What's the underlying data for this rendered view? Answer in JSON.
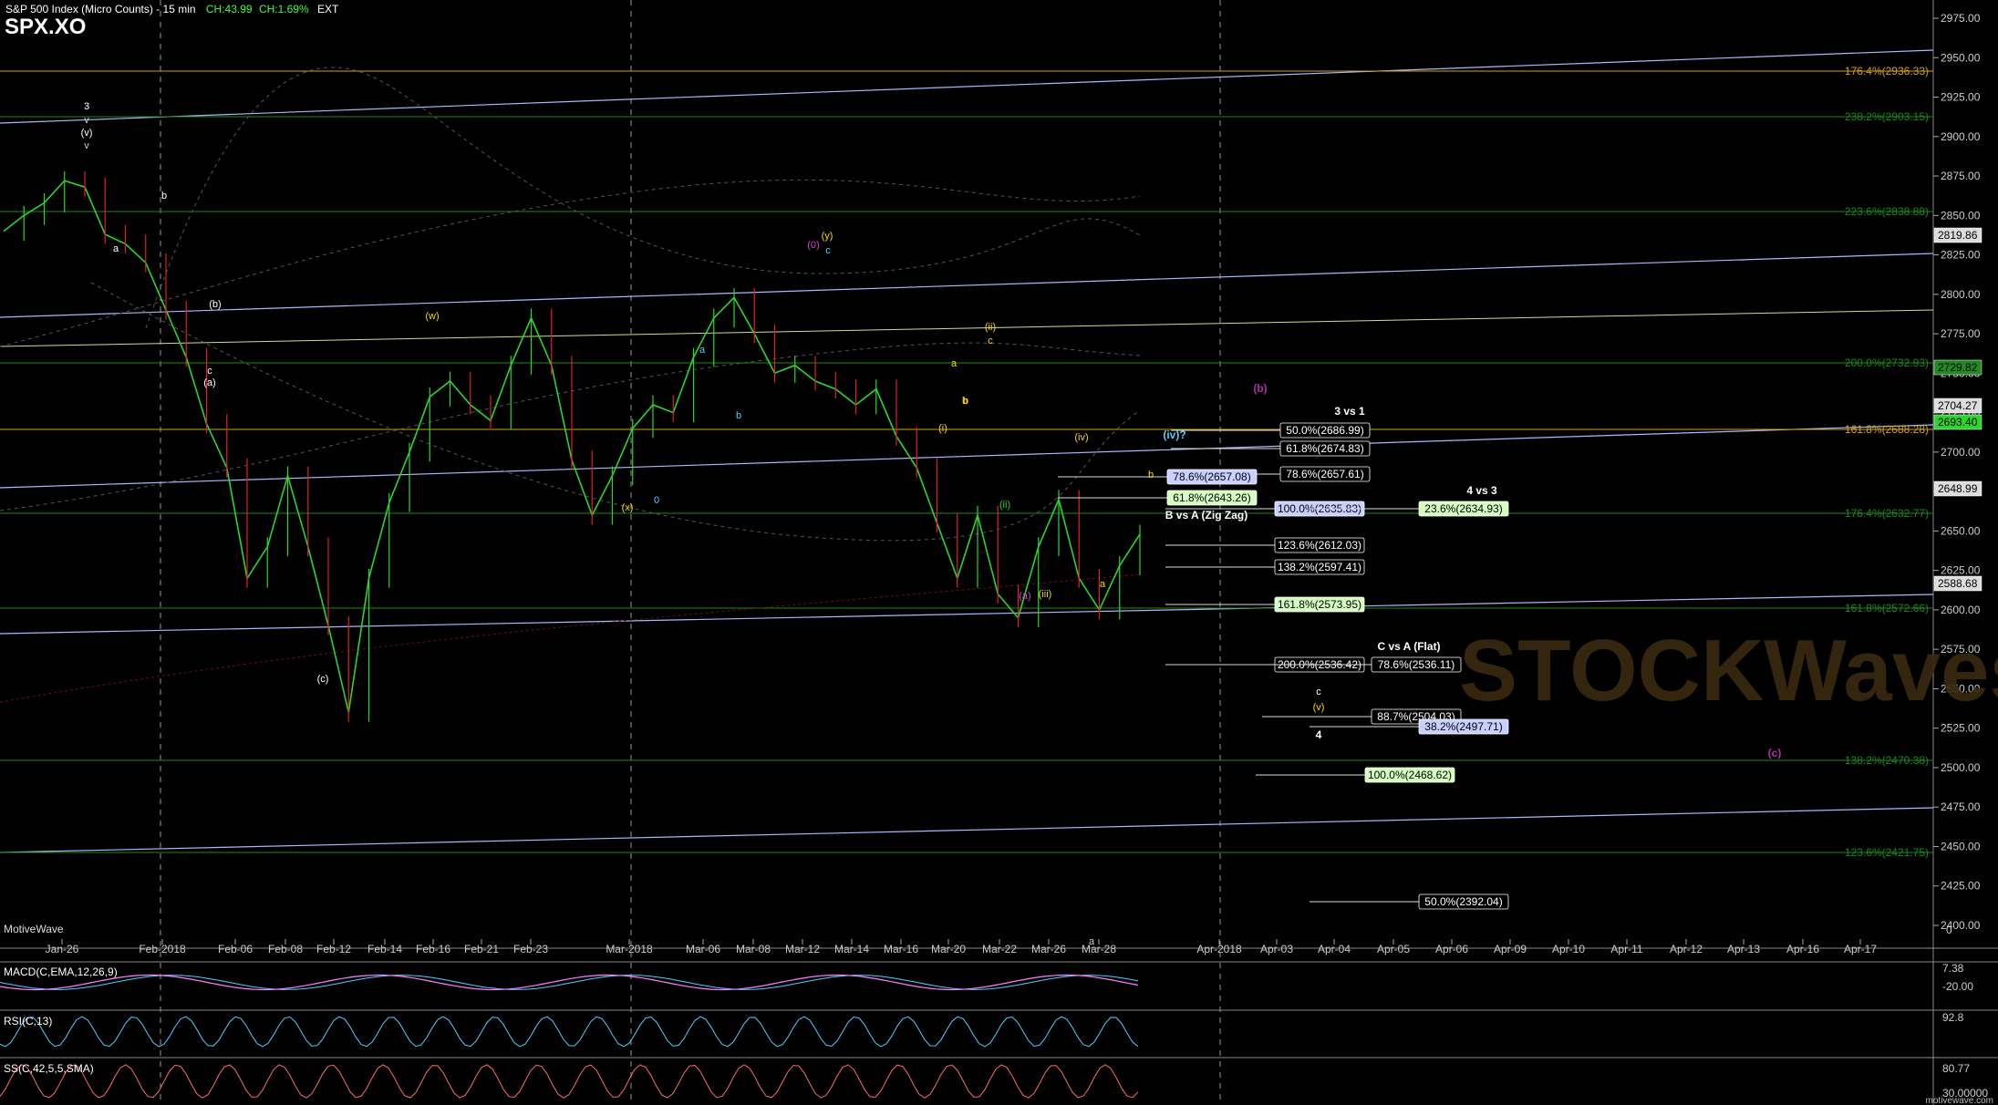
{
  "header": {
    "title": "S&P 500 Index (Micro Counts) - 15 min",
    "change": "CH:43.99",
    "change_pct": "CH:1.69%",
    "ext": "EXT",
    "symbol": "SPX.XO"
  },
  "branding": {
    "label": "MotiveWave",
    "watermark": "STOCKWaves"
  },
  "colors": {
    "background": "#000000",
    "price_up": "#2bd62b",
    "price_down": "#e02020",
    "trend_line": "#aab8ff",
    "fib_green": "#1a8a1a",
    "fib_orange": "#d4a017",
    "grid": "#666666"
  },
  "chart_data": [
    {
      "type": "line",
      "title": "S&P 500 Index (Micro Counts) - 15 min",
      "ylim": [
        2375,
        2990
      ],
      "y_ticks": [
        2975,
        2950,
        2925,
        2900,
        2875,
        2850,
        2825,
        2800,
        2775,
        2750,
        2725,
        2700,
        2675,
        2650,
        2625,
        2600,
        2575,
        2550,
        2525,
        2500,
        2475,
        2450,
        2425,
        2400
      ],
      "x_tick_labels": [
        "Jan-26",
        "Feb-2018",
        "Feb-06",
        "Feb-08",
        "Feb-12",
        "Feb-14",
        "Feb-16",
        "Feb-21",
        "Feb-23",
        "Mar-2018",
        "Mar-06",
        "Mar-08",
        "Mar-12",
        "Mar-14",
        "Mar-16",
        "Mar-20",
        "Mar-22",
        "Mar-26",
        "Mar-28",
        "Apr-2018",
        "Apr-03",
        "Apr-04",
        "Apr-05",
        "Apr-06",
        "Apr-09",
        "Apr-10",
        "Apr-11",
        "Apr-12",
        "Apr-13",
        "Apr-16",
        "Apr-17"
      ],
      "series": [
        {
          "values": [
            2840,
            2850,
            2858,
            2872,
            2868,
            2838,
            2832,
            2820,
            2790,
            2760,
            2718,
            2690,
            2620,
            2640,
            2685,
            2640,
            2590,
            2535,
            2620,
            2668,
            2700,
            2735,
            2745,
            2730,
            2720,
            2755,
            2785,
            2755,
            2695,
            2660,
            2685,
            2715,
            2730,
            2725,
            2760,
            2785,
            2798,
            2775,
            2750,
            2755,
            2745,
            2740,
            2730,
            2740,
            2710,
            2690,
            2655,
            2620,
            2660,
            2610,
            2595,
            2640,
            2670,
            2620,
            2600,
            2628,
            2648
          ]
        }
      ],
      "price_tags": [
        "2819.86",
        "2729.82",
        "2704.27",
        "2693.40",
        "2648.99",
        "2588.68"
      ],
      "fib_right_labels": [
        "176.4%(2936.33)",
        "238.2%(2903.15)",
        "223.6%(2838.88)",
        "200.0%(2732.93)",
        "161.8%(2688.28)",
        "176.4%(2632.77)",
        "161.8%(2572.66)",
        "138.2%(2470.38)",
        "123.6%(2421.75)"
      ],
      "fib_boxes": [
        "50.0%(2686.99)",
        "61.8%(2674.83)",
        "78.6%(2657.61)",
        "78.6%(2657.08)",
        "61.8%(2643.26)",
        "100.0%(2635.83)",
        "23.6%(2634.93)",
        "123.6%(2612.03)",
        "138.2%(2597.41)",
        "161.8%(2573.95)",
        "200.0%(2536.42)",
        "78.6%(2536.11)",
        "88.7%(2504.03)",
        "38.2%(2497.71)",
        "100.0%(2468.62)",
        "50.0%(2392.04)"
      ],
      "annotations": [
        "3 vs 1",
        "4 vs 3",
        "B vs A (Zig Zag)",
        "C vs A (Flat)",
        "(iv)?",
        "(b)",
        "(c)",
        "4"
      ],
      "wave_labels": [
        "3",
        "v",
        "(v)",
        "v",
        "a",
        "b",
        "(b)",
        "c",
        "(a)",
        "(c)",
        "a",
        "(w)",
        "(x)",
        "0",
        "a",
        "b",
        "(0)",
        "(y)",
        "c",
        "b",
        "(ii)",
        "c",
        "a",
        "b",
        "(i)",
        "(iii)",
        "(iv)",
        "b",
        "(a)",
        "(ii)",
        "a",
        "(v)",
        "c"
      ],
      "x_unit_label": "0"
    },
    {
      "type": "line",
      "title": "MACD(C,EMA,12,26,9)",
      "values_tag": [
        "7.38",
        "-20.00"
      ]
    },
    {
      "type": "line",
      "title": "RSI(C,13)",
      "values_tag": [
        "92.8"
      ]
    },
    {
      "type": "line",
      "title": "SS(C,42,5,5,SMA)",
      "values_tag": [
        "80.77",
        "30.00000"
      ]
    }
  ],
  "footer": {
    "url": "motivewave.com"
  }
}
